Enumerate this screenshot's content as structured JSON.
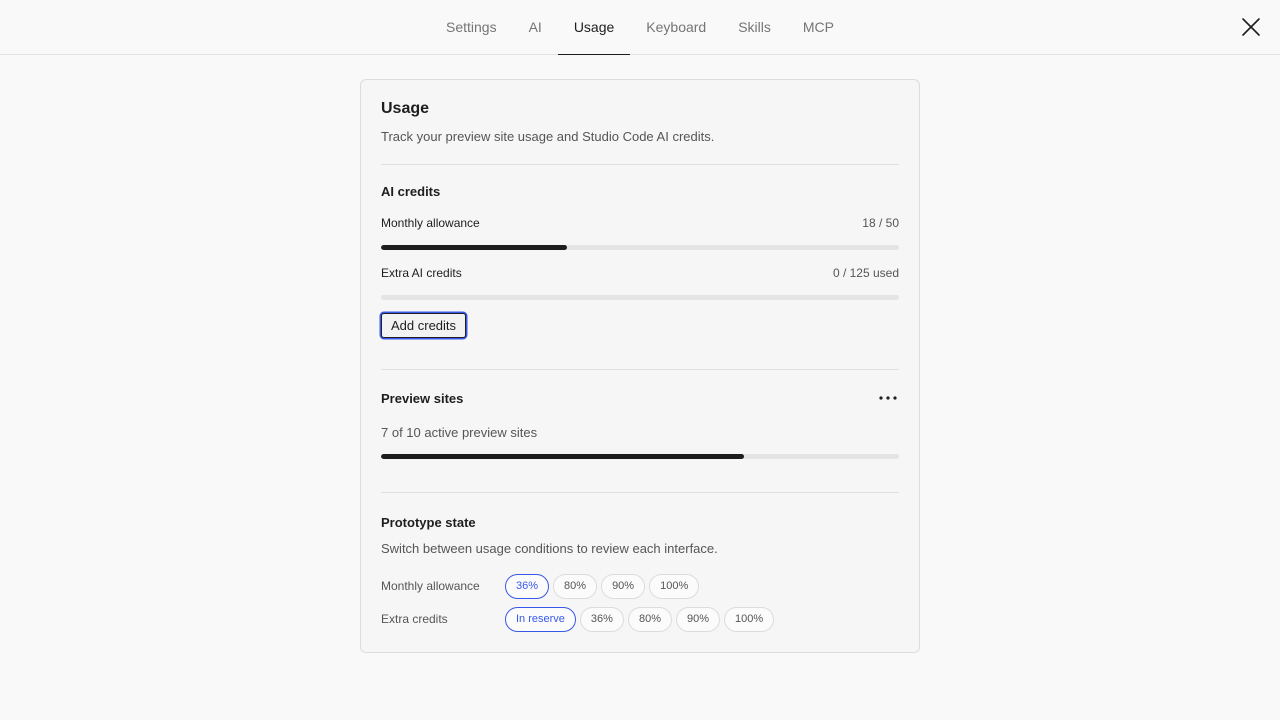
{
  "nav": {
    "tabs": [
      {
        "label": "Settings",
        "active": false
      },
      {
        "label": "AI",
        "active": false
      },
      {
        "label": "Usage",
        "active": true
      },
      {
        "label": "Keyboard",
        "active": false
      },
      {
        "label": "Skills",
        "active": false
      },
      {
        "label": "MCP",
        "active": false
      }
    ],
    "close_icon": "close-icon"
  },
  "usage": {
    "title": "Usage",
    "description": "Track your preview site usage and Studio Code AI credits."
  },
  "ai_credits": {
    "title": "AI credits",
    "monthly_label": "Monthly allowance",
    "monthly_value": "18 / 50",
    "monthly_fraction": 0.36,
    "extra_label": "Extra AI credits",
    "extra_value": "0 / 125 used",
    "extra_fraction": 0,
    "add_button_label": "Add credits"
  },
  "preview_sites": {
    "title": "Preview sites",
    "more_icon": "more-horizontal-icon",
    "summary": "7 of 10 active preview sites",
    "fraction": 0.7
  },
  "prototype_state": {
    "title": "Prototype state",
    "description": "Switch between usage conditions to review each interface.",
    "monthly_label": "Monthly allowance",
    "monthly_options": [
      "36%",
      "80%",
      "90%",
      "100%"
    ],
    "monthly_selected": "36%",
    "extra_label": "Extra credits",
    "extra_options": [
      "In reserve",
      "36%",
      "80%",
      "90%",
      "100%"
    ],
    "extra_selected": "In reserve"
  },
  "colors": {
    "accent": "#3858e9",
    "bar_fill": "#1e1e1e",
    "bar_track": "#e4e4e4"
  }
}
